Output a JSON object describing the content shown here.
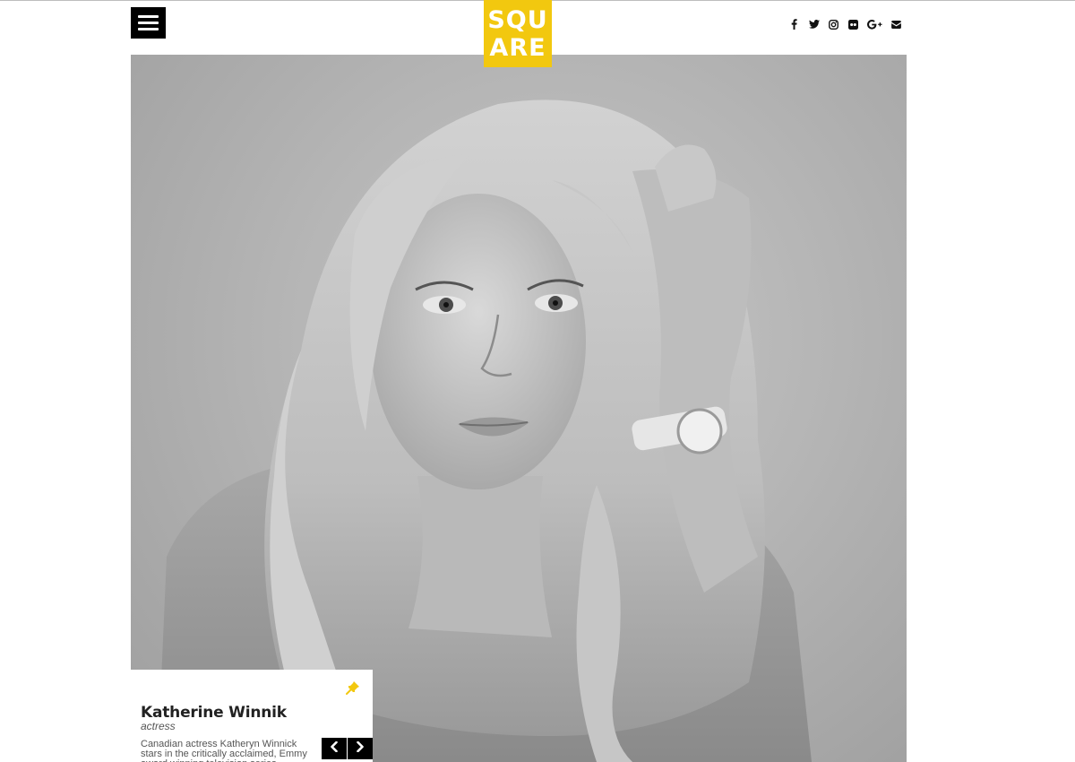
{
  "header": {
    "logo_line1": "SQU",
    "logo_line2": "ARE",
    "brand_color": "#f2c80f",
    "social": [
      "facebook-icon",
      "twitter-icon",
      "instagram-icon",
      "flickr-icon",
      "google-plus-icon",
      "envelope-icon"
    ]
  },
  "hero": {
    "image": "black-and-white portrait photograph"
  },
  "card": {
    "name": "Katherine Winnik",
    "role": "actress",
    "description": "Canadian actress Katheryn Winnick stars in the critically acclaimed, Emmy award winning television series",
    "pin_icon": "pin-icon",
    "prev_icon": "chevron-left-icon",
    "next_icon": "chevron-right-icon"
  }
}
